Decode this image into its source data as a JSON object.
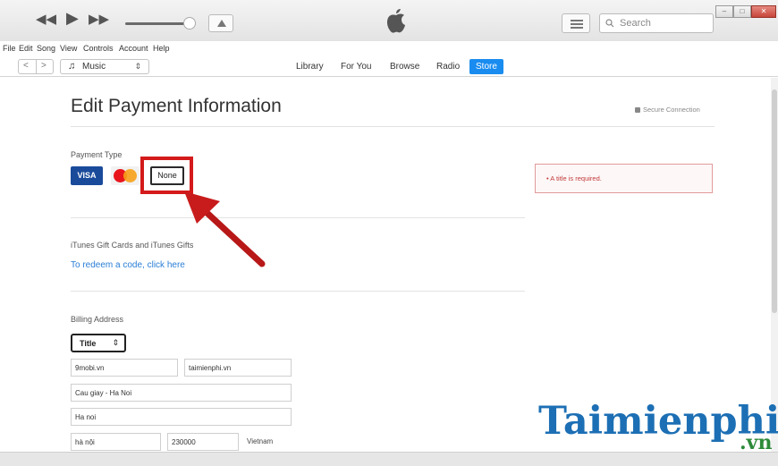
{
  "search": {
    "placeholder": "Search"
  },
  "menu": [
    "File",
    "Edit",
    "Song",
    "View",
    "Controls",
    "Account",
    "Help"
  ],
  "nav": {
    "media": "Music",
    "tabs": [
      "Library",
      "For You",
      "Browse",
      "Radio",
      "Store"
    ],
    "active_tab": "Store"
  },
  "page": {
    "title": "Edit Payment Information",
    "secure": "Secure Connection"
  },
  "payment": {
    "label": "Payment Type",
    "visa": "VISA",
    "none": "None"
  },
  "error": {
    "text": "•  A title is required."
  },
  "gift": {
    "label": "iTunes Gift Cards and iTunes Gifts",
    "link": "To redeem a code, click here"
  },
  "billing": {
    "label": "Billing Address",
    "title_select": "Title",
    "first_name": "9mobi.vn",
    "last_name": "taimienphi.vn",
    "street": "Cau giay - Ha Noi",
    "city": "Ha noi",
    "state": "hà nội",
    "postal_code": "230000",
    "country": "Vietnam"
  },
  "watermark": {
    "main": "Taimienphi",
    "sub": ".vn"
  },
  "colors": {
    "accent": "#1a8cf0",
    "highlight": "#d41a1a",
    "error": "#c23a3a",
    "link": "#2a7ed6",
    "visa": "#1a4b9b"
  },
  "icons": [
    "rewind-icon",
    "play-icon",
    "fast-forward-icon",
    "airplay-icon",
    "apple-logo-icon",
    "list-icon",
    "search-icon",
    "music-note-icon",
    "lock-icon",
    "red-arrow-annotation"
  ]
}
